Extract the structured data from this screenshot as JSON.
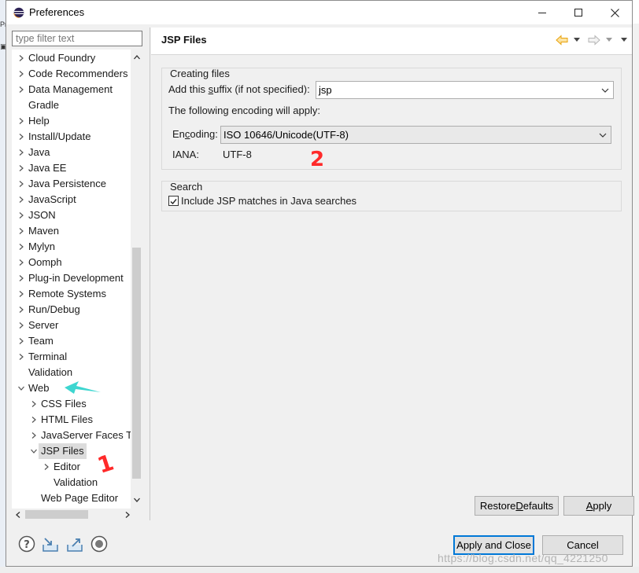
{
  "window": {
    "title": "Preferences"
  },
  "background": {
    "left_fragment": [
      "Pr",
      "▣"
    ],
    "watermark": "https://blog.csdn.net/qq_4221250"
  },
  "filter": {
    "placeholder": "type filter text",
    "value": ""
  },
  "tree": [
    {
      "label": "Cloud Foundry",
      "level": 0,
      "expander": "collapsed"
    },
    {
      "label": "Code Recommenders",
      "level": 0,
      "expander": "collapsed"
    },
    {
      "label": "Data Management",
      "level": 0,
      "expander": "collapsed"
    },
    {
      "label": "Gradle",
      "level": 0,
      "expander": "none"
    },
    {
      "label": "Help",
      "level": 0,
      "expander": "collapsed"
    },
    {
      "label": "Install/Update",
      "level": 0,
      "expander": "collapsed"
    },
    {
      "label": "Java",
      "level": 0,
      "expander": "collapsed"
    },
    {
      "label": "Java EE",
      "level": 0,
      "expander": "collapsed"
    },
    {
      "label": "Java Persistence",
      "level": 0,
      "expander": "collapsed"
    },
    {
      "label": "JavaScript",
      "level": 0,
      "expander": "collapsed"
    },
    {
      "label": "JSON",
      "level": 0,
      "expander": "collapsed"
    },
    {
      "label": "Maven",
      "level": 0,
      "expander": "collapsed"
    },
    {
      "label": "Mylyn",
      "level": 0,
      "expander": "collapsed"
    },
    {
      "label": "Oomph",
      "level": 0,
      "expander": "collapsed"
    },
    {
      "label": "Plug-in Development",
      "level": 0,
      "expander": "collapsed"
    },
    {
      "label": "Remote Systems",
      "level": 0,
      "expander": "collapsed"
    },
    {
      "label": "Run/Debug",
      "level": 0,
      "expander": "collapsed"
    },
    {
      "label": "Server",
      "level": 0,
      "expander": "collapsed"
    },
    {
      "label": "Team",
      "level": 0,
      "expander": "collapsed"
    },
    {
      "label": "Terminal",
      "level": 0,
      "expander": "collapsed"
    },
    {
      "label": "Validation",
      "level": 0,
      "expander": "none"
    },
    {
      "label": "Web",
      "level": 0,
      "expander": "expanded"
    },
    {
      "label": "CSS Files",
      "level": 1,
      "expander": "collapsed"
    },
    {
      "label": "HTML Files",
      "level": 1,
      "expander": "collapsed"
    },
    {
      "label": "JavaServer Faces Tools",
      "level": 1,
      "expander": "collapsed"
    },
    {
      "label": "JSP Files",
      "level": 1,
      "expander": "expanded",
      "selected": true
    },
    {
      "label": "Editor",
      "level": 2,
      "expander": "collapsed"
    },
    {
      "label": "Validation",
      "level": 2,
      "expander": "none"
    },
    {
      "label": "Web Page Editor",
      "level": 1,
      "expander": "none"
    }
  ],
  "page": {
    "title": "JSP Files",
    "creating": {
      "group_label": "Creating files",
      "suffix_label_pre": "Add this ",
      "suffix_label_mnemonic": "s",
      "suffix_label_post": "uffix (if not specified):",
      "suffix_value": "jsp",
      "encoding_note": "The following encoding will apply:",
      "encoding_label_pre": "En",
      "encoding_label_mnemonic": "c",
      "encoding_label_post": "oding:",
      "encoding_value": "ISO 10646/Unicode(UTF-8)",
      "iana_label": "IANA:",
      "iana_value": "UTF-8"
    },
    "search": {
      "group_label": "Search",
      "include_label": "Include JSP matches in Java searches",
      "include_checked": true
    },
    "restore_pre": "Restore ",
    "restore_mnemonic": "D",
    "restore_post": "efaults",
    "apply_pre": "",
    "apply_mnemonic": "A",
    "apply_post": "pply"
  },
  "footer": {
    "apply_close_label": "Apply and Close",
    "cancel_label": "Cancel"
  },
  "annotations": {
    "mark1": "1",
    "mark2": "2",
    "color_red": "#ff2a2a",
    "color_cyan": "#3dd6d0"
  },
  "colors": {
    "accent": "#0078d7",
    "nav_back": "#e9a20b",
    "selection": "#dcdcdc"
  }
}
